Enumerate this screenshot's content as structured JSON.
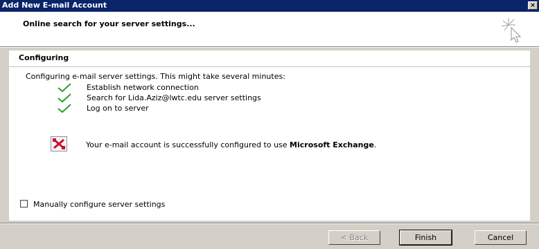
{
  "window": {
    "title": "Add New E-mail Account",
    "close_glyph": "×"
  },
  "header": {
    "title": "Online search for your server settings...",
    "icon": "wizard-cursor-icon"
  },
  "panel": {
    "title": "Configuring",
    "intro": "Configuring e-mail server settings. This might take several minutes:",
    "steps": [
      {
        "label": "Establish network connection",
        "status": "done"
      },
      {
        "label": "Search for Lida.Aziz@lwtc.edu server settings",
        "status": "done"
      },
      {
        "label": "Log on to server",
        "status": "done"
      }
    ],
    "success_prefix": "Your e-mail account is successfully configured to use ",
    "success_product": "Microsoft Exchange",
    "success_suffix": "."
  },
  "options": {
    "manual_config_label": "Manually configure server settings",
    "manual_config_checked": false
  },
  "buttons": {
    "back": "< Back",
    "finish": "Finish",
    "cancel": "Cancel"
  },
  "colors": {
    "titlebar": "#0a246a",
    "check": "#2e9e2e",
    "exchange_red": "#c8102e"
  }
}
